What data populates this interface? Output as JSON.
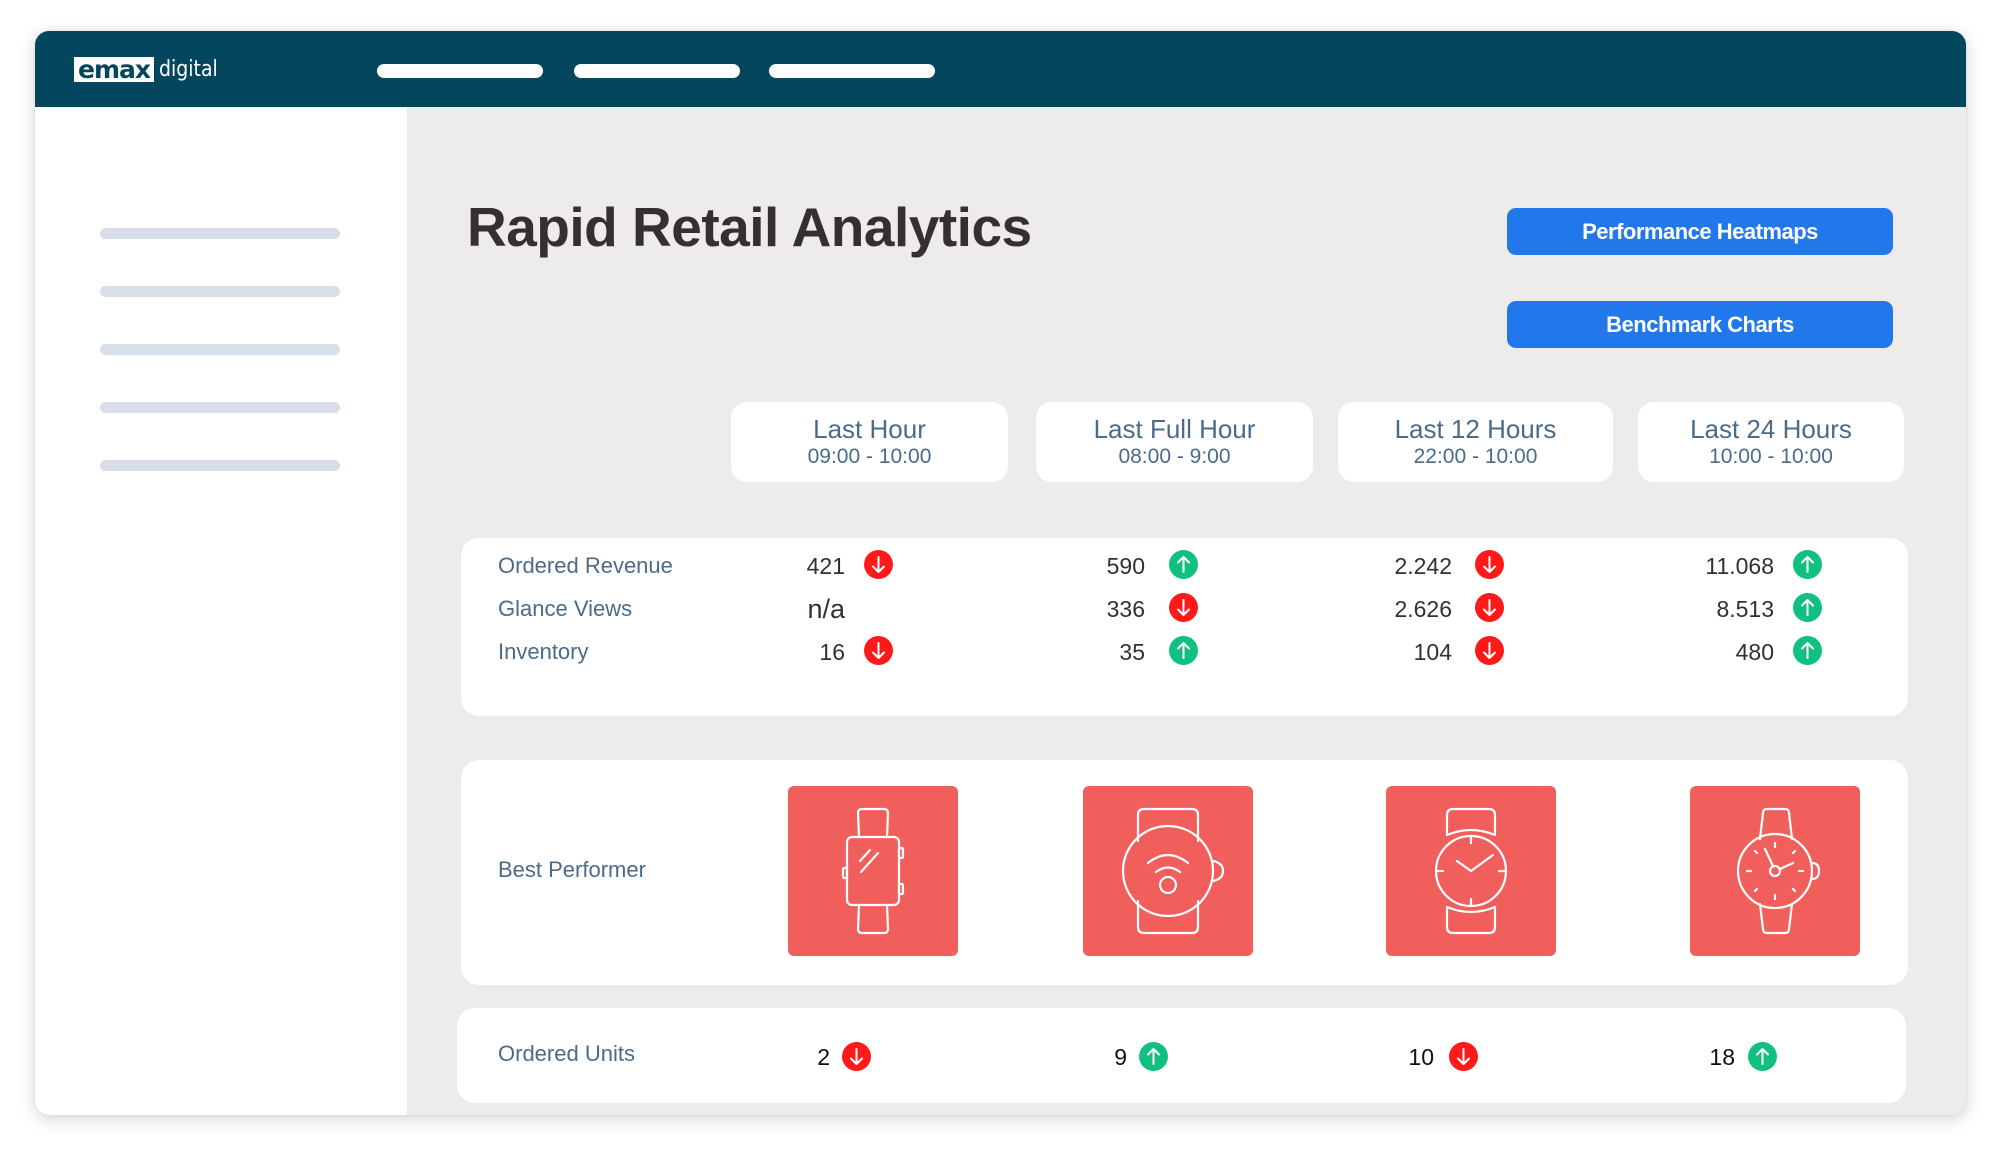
{
  "brand": {
    "logo_mark": "emax",
    "logo_text": "digital"
  },
  "header": {
    "nav_items": [
      "",
      "",
      ""
    ]
  },
  "sidebar": {
    "items": [
      "",
      "",
      "",
      "",
      ""
    ]
  },
  "page": {
    "title": "Rapid Retail Analytics"
  },
  "actions": {
    "heatmaps_label": "Performance Heatmaps",
    "benchmark_label": "Benchmark Charts"
  },
  "colors": {
    "header": "#05465F",
    "accent_button": "#2178EB",
    "trend_down": "#FF1A1A",
    "trend_up": "#10C07F",
    "product_tile": "#F05F5C",
    "label_text": "#4A6B8A"
  },
  "periods": [
    {
      "title": "Last Hour",
      "range": "09:00 - 10:00"
    },
    {
      "title": "Last Full Hour",
      "range": "08:00 - 9:00"
    },
    {
      "title": "Last 12 Hours",
      "range": "22:00 - 10:00"
    },
    {
      "title": "Last 24 Hours",
      "range": "10:00 - 10:00"
    }
  ],
  "metrics": [
    {
      "label": "Ordered Revenue",
      "values": [
        {
          "value": "421",
          "trend": "down"
        },
        {
          "value": "590",
          "trend": "up"
        },
        {
          "value": "2.242",
          "trend": "down"
        },
        {
          "value": "11.068",
          "trend": "up"
        }
      ]
    },
    {
      "label": "Glance Views",
      "values": [
        {
          "value": "n/a",
          "trend": "none"
        },
        {
          "value": "336",
          "trend": "down"
        },
        {
          "value": "2.626",
          "trend": "down"
        },
        {
          "value": "8.513",
          "trend": "up"
        }
      ]
    },
    {
      "label": "Inventory",
      "values": [
        {
          "value": "16",
          "trend": "down"
        },
        {
          "value": "35",
          "trend": "up"
        },
        {
          "value": "104",
          "trend": "down"
        },
        {
          "value": "480",
          "trend": "up"
        }
      ]
    }
  ],
  "best_performer": {
    "label": "Best Performer",
    "products": [
      {
        "icon": "smartwatch-square-icon"
      },
      {
        "icon": "smartwatch-round-wireless-icon"
      },
      {
        "icon": "analog-watch-icon"
      },
      {
        "icon": "classic-watch-icon"
      }
    ]
  },
  "ordered_units": {
    "label": "Ordered Units",
    "values": [
      {
        "value": "2",
        "trend": "down"
      },
      {
        "value": "9",
        "trend": "up"
      },
      {
        "value": "10",
        "trend": "down"
      },
      {
        "value": "18",
        "trend": "up"
      }
    ]
  }
}
